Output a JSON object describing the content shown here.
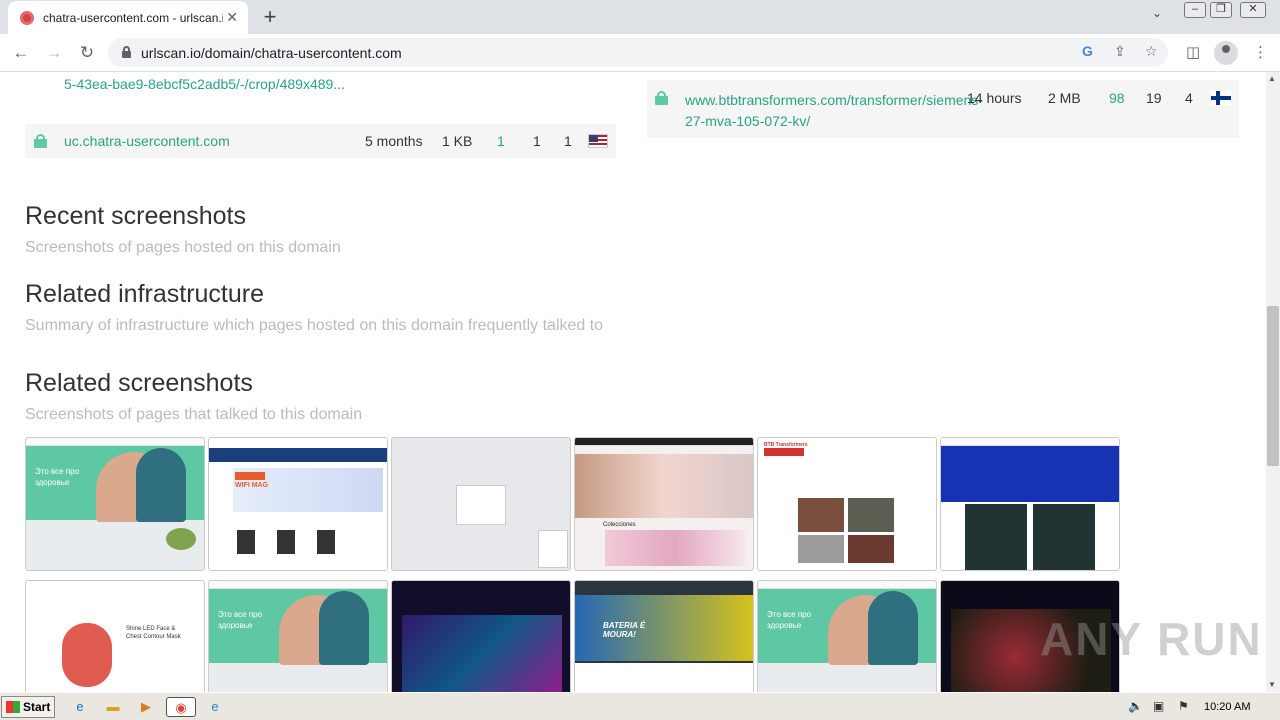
{
  "browser": {
    "tab_title": "chatra-usercontent.com - urlscan.io",
    "tab_close": "✕",
    "new_tab": "+",
    "url": "urlscan.io/domain/chatra-usercontent.com",
    "back": "←",
    "forward": "→",
    "reload": "↻"
  },
  "page": {
    "top_link": "5-43ea-bae9-8ebcf5c2adb5/-/crop/489x489...",
    "left_row": {
      "domain": "uc.chatra-usercontent.com",
      "age": "5 months",
      "size": "1 KB",
      "ips": "1",
      "countries": "1",
      "requests": "1",
      "flag": "us-flag"
    },
    "right_row": {
      "url": "www.btbtransformers.com/transformer/siemens-27-mva-105-072-kv/",
      "age": "14 hours",
      "size": "2 MB",
      "requests": "98",
      "ips": "19",
      "countries": "4",
      "flag": "fi-flag"
    },
    "recent_screenshots": {
      "title": "Recent screenshots",
      "subtitle": "Screenshots of pages hosted on this domain"
    },
    "related_infrastructure": {
      "title": "Related infrastructure",
      "subtitle": "Summary of infrastructure which pages hosted on this domain frequently talked to"
    },
    "related_screenshots": {
      "title": "Related screenshots",
      "subtitle": "Screenshots of pages that talked to this domain"
    },
    "thumb_text": {
      "green_heading": "Это все про здоровье",
      "wifi_logo": "WIFI MAG",
      "shop_label": "Colecciones",
      "btb_logo": "BTB Transformers",
      "moura_text": "BATERIA É MOURA!",
      "mask_text": "Shine LED Face & Chest Contour Mask"
    }
  },
  "watermark": "ANY RUN",
  "taskbar": {
    "start_label": "Start",
    "clock": "10:20 AM"
  }
}
